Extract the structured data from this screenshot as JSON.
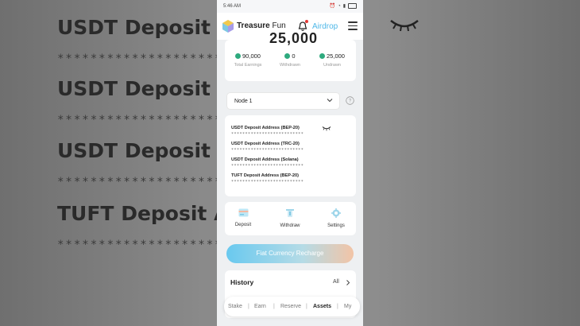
{
  "background": {
    "lines": [
      "USDT Deposit Ad",
      "USDT Deposit Ad",
      "USDT Deposit Ad",
      "TUFT Deposit Ad"
    ],
    "masked": "**********************************"
  },
  "status_bar": {
    "time": "5:46 AM"
  },
  "header": {
    "brand": "Treasure",
    "brand_suffix": "Fun",
    "airdrop": "Airdrop"
  },
  "balance": {
    "amount": "25,000",
    "stats": [
      {
        "value": "90,000",
        "label": "Total Earnings"
      },
      {
        "value": "0",
        "label": "Withdrawn"
      },
      {
        "value": "25,000",
        "label": "Undrawn"
      }
    ]
  },
  "node": {
    "selected": "Node 1"
  },
  "addresses": [
    {
      "title": "USDT Deposit Address (BEP-20)",
      "masked": "**************************"
    },
    {
      "title": "USDT Deposit Address (TRC-20)",
      "masked": "**************************"
    },
    {
      "title": "USDT Deposit Address (Solana)",
      "masked": "**************************"
    },
    {
      "title": "TUFT Deposit Address (BEP-20)",
      "masked": "**************************"
    }
  ],
  "actions": [
    {
      "label": "Deposit"
    },
    {
      "label": "Withdraw"
    },
    {
      "label": "Settings"
    }
  ],
  "recharge_label": "Fiat Currency Recharge",
  "history": {
    "title": "History",
    "all": "All"
  },
  "bottom_nav": {
    "tabs": [
      "Stake",
      "Earn",
      "Reserve",
      "Assets",
      "My"
    ],
    "active": "Assets"
  },
  "colors": {
    "accent": "#2eaa7e",
    "airdrop": "#4fb8e8",
    "recharge_start": "#69c9ef",
    "recharge_end": "#f2c4a6"
  }
}
